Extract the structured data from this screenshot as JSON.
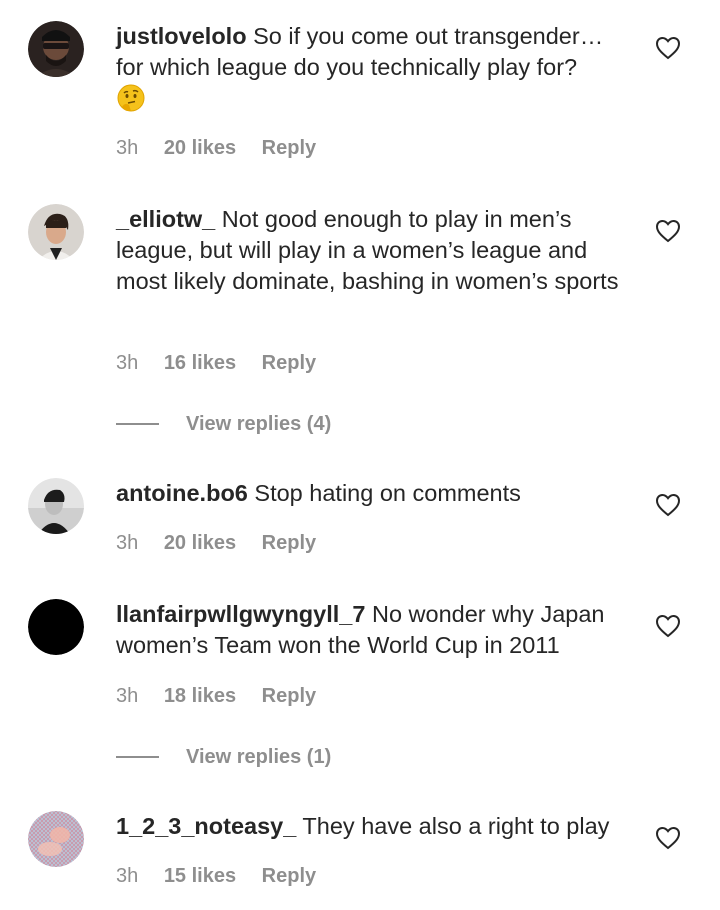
{
  "comments": [
    {
      "username": "justlovelolo",
      "text": "So if you come out transgender… for which league do you technically play for?",
      "emoji": "thinking-face",
      "time": "3h",
      "likes": "20 likes",
      "reply": "Reply",
      "icon": "heart-outline-icon"
    },
    {
      "username": "_elliotw_",
      "text": "Not good enough to play in men’s league, but will play in a women’s league and most likely dominate, bashing in women’s sports",
      "time": "3h",
      "likes": "16 likes",
      "reply": "Reply",
      "view_replies": "View replies (4)",
      "icon": "heart-outline-icon"
    },
    {
      "username": "antoine.bo6",
      "text": "Stop hating on comments",
      "time": "3h",
      "likes": "20 likes",
      "reply": "Reply",
      "icon": "heart-outline-icon"
    },
    {
      "username": "llanfairpwllgwyngyll_7",
      "text": "No wonder why Japan women’s Team won the World Cup in 2011",
      "time": "3h",
      "likes": "18 likes",
      "reply": "Reply",
      "view_replies": "View replies (1)",
      "icon": "heart-outline-icon"
    },
    {
      "username": "1_2_3_noteasy_",
      "text": "They have also a right to play",
      "time": "3h",
      "likes": "15 likes",
      "reply": "Reply",
      "icon": "heart-outline-icon"
    }
  ],
  "colors": {
    "text": "#262626",
    "secondary": "#8e8e8e",
    "background": "#ffffff"
  }
}
